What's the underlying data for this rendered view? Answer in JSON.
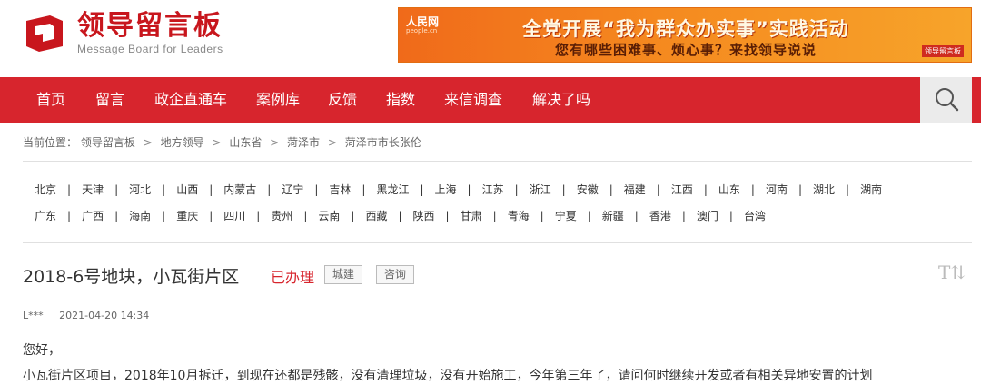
{
  "header": {
    "logo_title": "领导留言板",
    "logo_subtitle": "Message Board for Leaders",
    "brand_color": "#c8161d"
  },
  "banner": {
    "site": "人民网",
    "site_sub": "people.cn",
    "headline": "全党开展“我为群众办实事”实践活动",
    "subline": "您有哪些困难事、烦心事？来找领导说说",
    "tag": "领导留言板"
  },
  "nav": {
    "items": [
      "首页",
      "留言",
      "政企直通车",
      "案例库",
      "反馈",
      "指数",
      "来信调查",
      "解决了吗"
    ],
    "search_icon": "search-icon",
    "bg_color": "#d7252d"
  },
  "breadcrumb": {
    "prefix": "当前位置：",
    "items": [
      "领导留言板",
      "地方领导",
      "山东省",
      "菏泽市",
      "菏泽市市长张伦"
    ]
  },
  "provinces": {
    "row1": [
      "北京",
      "天津",
      "河北",
      "山西",
      "内蒙古",
      "辽宁",
      "吉林",
      "黑龙江",
      "上海",
      "江苏",
      "浙江",
      "安徽",
      "福建",
      "江西",
      "山东",
      "河南",
      "湖北",
      "湖南"
    ],
    "row2": [
      "广东",
      "广西",
      "海南",
      "重庆",
      "四川",
      "贵州",
      "云南",
      "西藏",
      "陕西",
      "甘肃",
      "青海",
      "宁夏",
      "新疆",
      "香港",
      "澳门",
      "台湾"
    ]
  },
  "message": {
    "title": "2018-6号地块，小瓦街片区",
    "status": "已办理",
    "tags": [
      "城建",
      "咨询"
    ],
    "font_toggle": "T⇅",
    "author": "L***",
    "date": "2021-04-20 14:34",
    "greeting": "您好，",
    "body": "小瓦街片区项目，2018年10月拆迁，到现在还都是残骸，没有清理垃圾，没有开始施工，今年第三年了，请问何时继续开发或者有相关异地安置的计划"
  }
}
